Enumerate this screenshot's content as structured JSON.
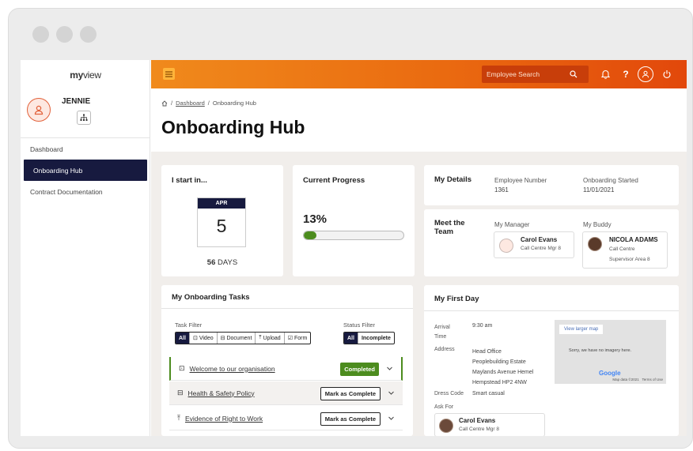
{
  "app": {
    "logo_text": "myview"
  },
  "sidebar": {
    "user_name": "JENNIE",
    "nav_items": [
      {
        "label": "Dashboard",
        "active": false
      },
      {
        "label": "Onboarding Hub",
        "active": true
      },
      {
        "label": "Contract Documentation",
        "active": false
      }
    ]
  },
  "topbar": {
    "search_placeholder": "Employee Search",
    "icons": [
      "menu-icon",
      "search-icon",
      "bell-icon",
      "help-icon",
      "user-icon",
      "power-icon"
    ]
  },
  "page": {
    "breadcrumb": {
      "home_icon": "home-icon",
      "dashboard": "Dashboard",
      "current": "Onboarding Hub"
    },
    "title": "Onboarding Hub"
  },
  "start_card": {
    "title": "I start in...",
    "month": "APR",
    "day": "5",
    "days_num": "56",
    "days_label": "DAYS"
  },
  "progress_card": {
    "title": "Current Progress",
    "percent_label": "13%",
    "percent": 13
  },
  "details_card": {
    "title": "My Details",
    "employee_number_label": "Employee Number",
    "employee_number": "1361",
    "onboarding_started_label": "Onboarding Started",
    "onboarding_started": "11/01/2021"
  },
  "team_card": {
    "title_line1": "Meet the",
    "title_line2": "Team",
    "manager_label": "My Manager",
    "manager_name": "Carol Evans",
    "manager_role": "Call Centre Mgr 8",
    "buddy_label": "My Buddy",
    "buddy_name": "NICOLA ADAMS",
    "buddy_role_line1": "Call Centre",
    "buddy_role_line2": "Supervisor Area 8"
  },
  "tasks_card": {
    "title": "My Onboarding Tasks",
    "task_filter_label": "Task Filter",
    "task_filters": [
      "All",
      "Video",
      "Document",
      "Upload",
      "Form"
    ],
    "status_filter_label": "Status Filter",
    "status_filters": [
      "All",
      "Incomplete"
    ],
    "tasks": [
      {
        "name": "Welcome to our organisation",
        "icon": "video-icon",
        "action": "Completed"
      },
      {
        "name": "Health & Safety Policy",
        "icon": "document-icon",
        "action": "Mark as Complete"
      },
      {
        "name": "Evidence of Right to Work",
        "icon": "upload-icon",
        "action": "Mark as Complete"
      }
    ],
    "colors": {
      "completed": "#4c8c1e",
      "accent": "#171a3f"
    }
  },
  "first_day_card": {
    "title": "My First Day",
    "arrival_label_line1": "Arrival",
    "arrival_label_line2": "Time",
    "arrival_time": "9:30 am",
    "address_label": "Address",
    "address_lines": [
      "Head Office",
      "Peoplebuilding Estate",
      "Maylands Avenue Hemel",
      "Hempstead HP2 4NW"
    ],
    "dress_code_label": "Dress Code",
    "dress_code": "Smart casual",
    "ask_for_label": "Ask For",
    "ask_for_name": "Carol Evans",
    "ask_for_role": "Call Centre Mgr 8",
    "map": {
      "button": "View larger map",
      "message": "Sorry, we have no imagery here.",
      "logo": "Google",
      "footer_data": "Map data ©2021",
      "footer_terms": "Terms of Use"
    }
  }
}
